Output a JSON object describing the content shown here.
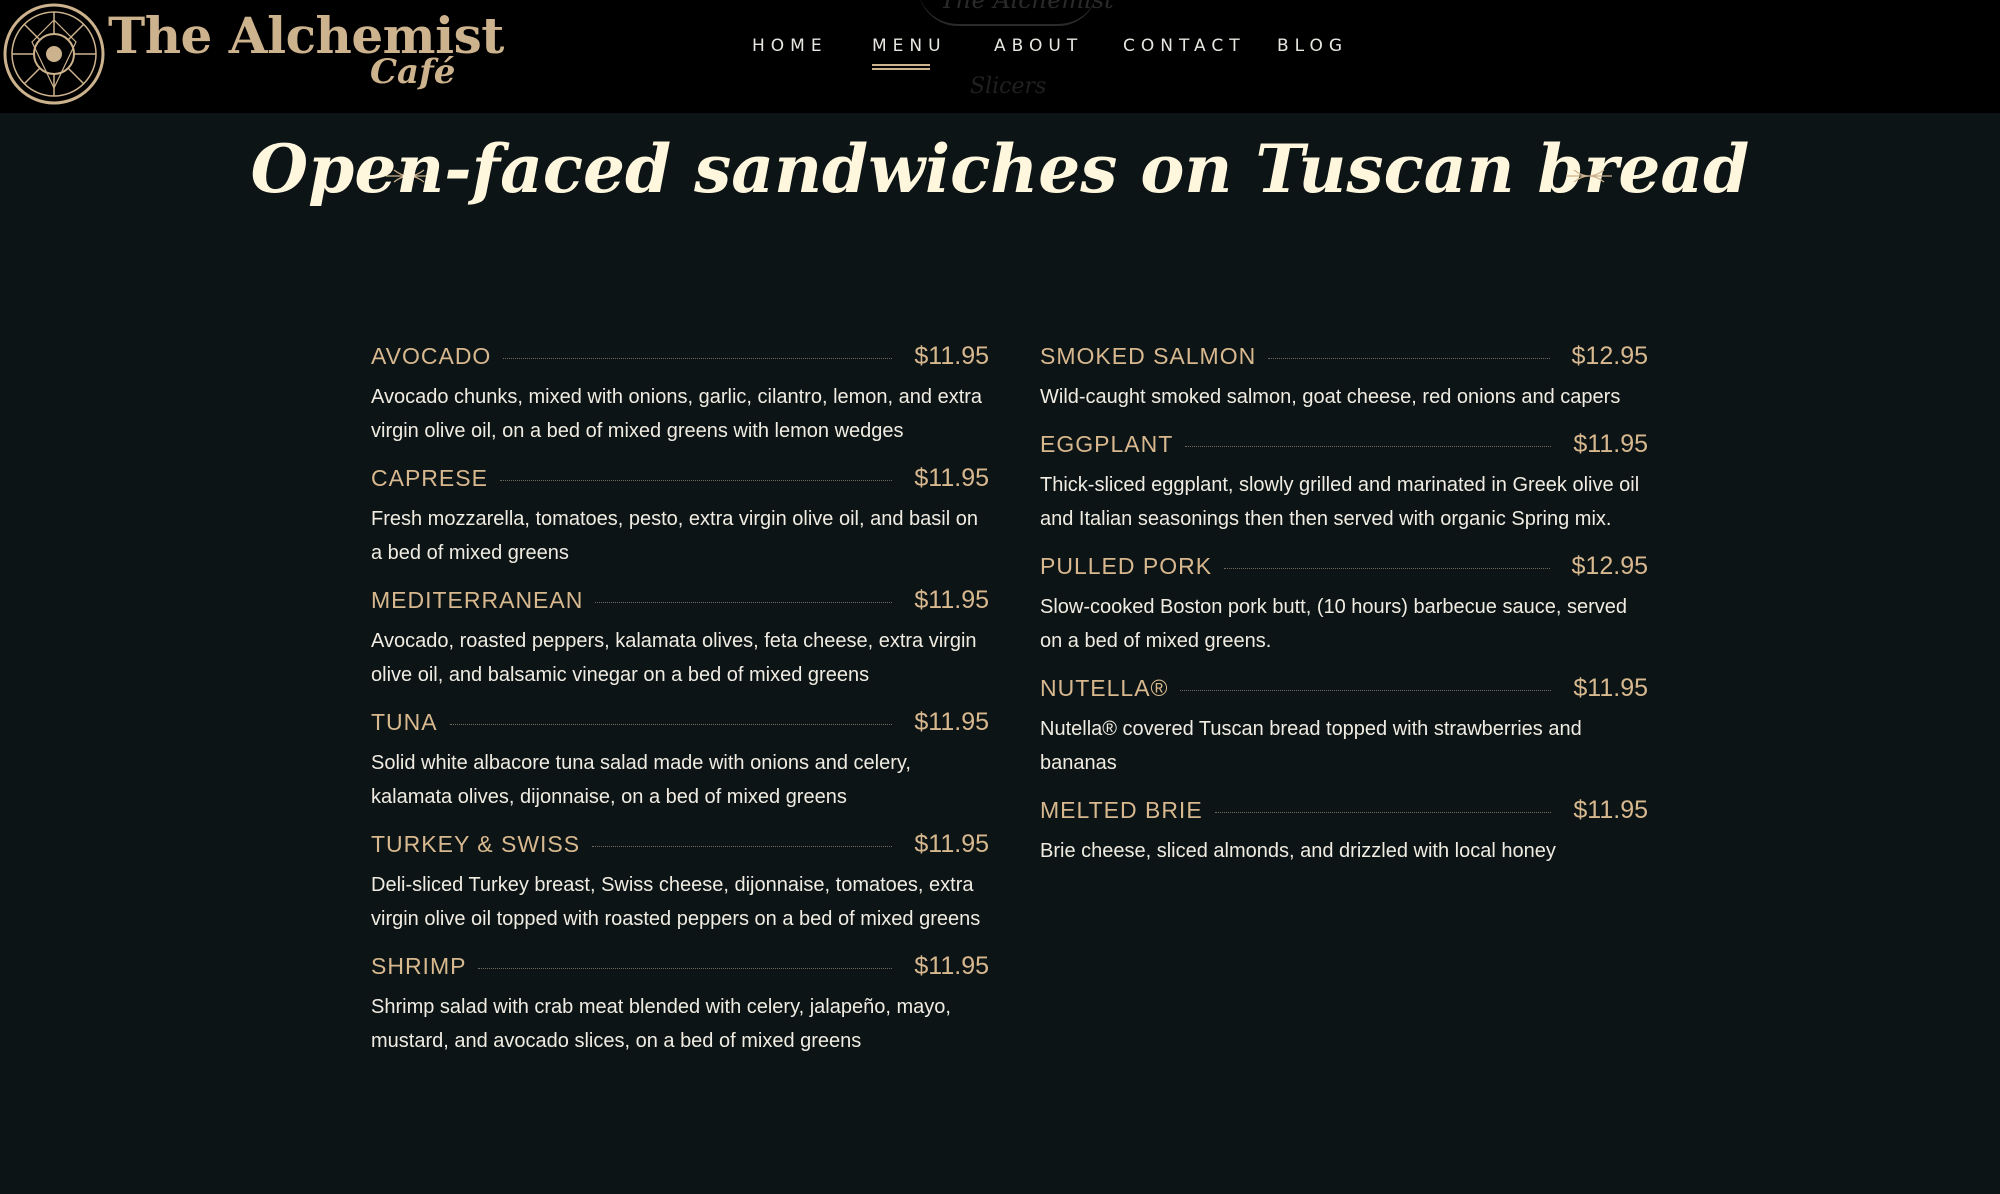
{
  "brand": {
    "name": "The Alchemist",
    "sub": "Café",
    "ghost_name": "The Alchemist",
    "ghost_sub": "Slicers"
  },
  "nav": {
    "items": [
      {
        "label": "HOME"
      },
      {
        "label": "MENU",
        "active": true
      },
      {
        "label": "ABOUT"
      },
      {
        "label": "CONTACT"
      },
      {
        "label": "BLOG"
      }
    ]
  },
  "page": {
    "title": "Open-faced sandwiches on Tuscan bread"
  },
  "colors": {
    "background": "#0c1416",
    "header": "#000000",
    "accent_gold": "#d8b88e",
    "title": "#fff6de"
  },
  "menu": {
    "left": [
      {
        "name": "AVOCADO",
        "price": "$11.95",
        "description": "Avocado chunks, mixed with onions, garlic, cilantro, lemon, and extra virgin olive oil, on a bed of mixed greens with lemon wedges"
      },
      {
        "name": "CAPRESE",
        "price": "$11.95",
        "description": "Fresh mozzarella, tomatoes, pesto, extra virgin olive oil, and basil on a bed of mixed greens"
      },
      {
        "name": "MEDITERRANEAN",
        "price": "$11.95",
        "description": "Avocado, roasted peppers, kalamata olives, feta cheese, extra virgin olive oil, and balsamic vinegar on a bed of mixed greens"
      },
      {
        "name": "TUNA",
        "price": "$11.95",
        "description": "Solid white albacore tuna salad made with onions and celery, kalamata olives, dijonnaise, on a bed of mixed greens"
      },
      {
        "name": "TURKEY & SWISS",
        "price": "$11.95",
        "description": "Deli-sliced Turkey breast, Swiss cheese, dijonnaise, tomatoes, extra virgin olive oil topped with roasted peppers on a bed of mixed greens"
      },
      {
        "name": "SHRIMP",
        "price": "$11.95",
        "description": "Shrimp salad with crab meat blended with celery, jalapeño, mayo, mustard, and avocado slices, on a bed of mixed greens"
      }
    ],
    "right": [
      {
        "name": "SMOKED SALMON",
        "price": "$12.95",
        "description": "Wild-caught smoked salmon, goat cheese, red onions and capers"
      },
      {
        "name": "EGGPLANT",
        "price": "$11.95",
        "description": "Thick-sliced eggplant, slowly grilled and marinated in Greek olive oil and Italian seasonings then then served with organic Spring mix."
      },
      {
        "name": "PULLED PORK",
        "price": "$12.95",
        "description": "Slow-cooked Boston pork butt, (10 hours) barbecue sauce, served on a bed of mixed greens."
      },
      {
        "name": "NUTELLA®",
        "price": "$11.95",
        "description": "Nutella® covered Tuscan bread topped with strawberries and bananas"
      },
      {
        "name": "MELTED BRIE",
        "price": "$11.95",
        "description": "Brie cheese, sliced almonds, and drizzled with local honey"
      }
    ]
  }
}
